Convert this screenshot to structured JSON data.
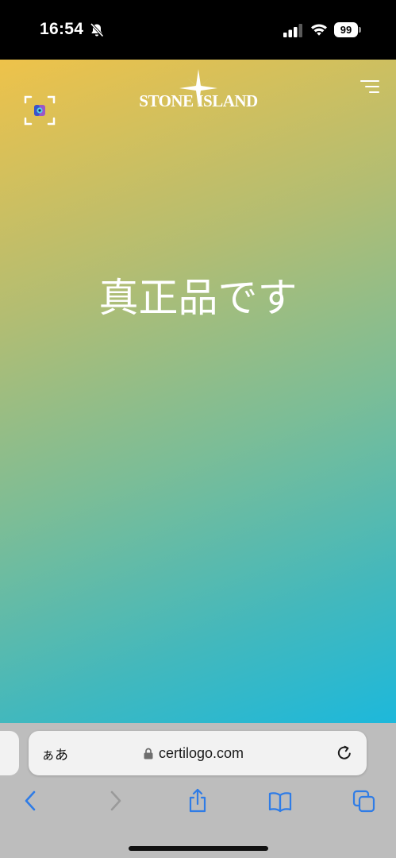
{
  "status_bar": {
    "time": "16:54",
    "battery": "99",
    "icons": [
      "bell-slash-icon",
      "signal-icon",
      "wifi-icon",
      "battery-icon"
    ]
  },
  "page": {
    "brand": "STONE ISLAND",
    "headline": "真正品です",
    "icons": [
      "scan-icon",
      "menu-icon",
      "compass-star-icon"
    ],
    "gradient_colors": [
      "#eec24a",
      "#b3bd72",
      "#7bbd97",
      "#42b8bd",
      "#1db8db"
    ]
  },
  "browser": {
    "reader_label": "ぁあ",
    "url": "certilogo.com",
    "accent_color": "#2f7ce6",
    "toolbar_icons": [
      "back-icon",
      "forward-icon",
      "share-icon",
      "bookmarks-icon",
      "tabs-icon"
    ]
  }
}
